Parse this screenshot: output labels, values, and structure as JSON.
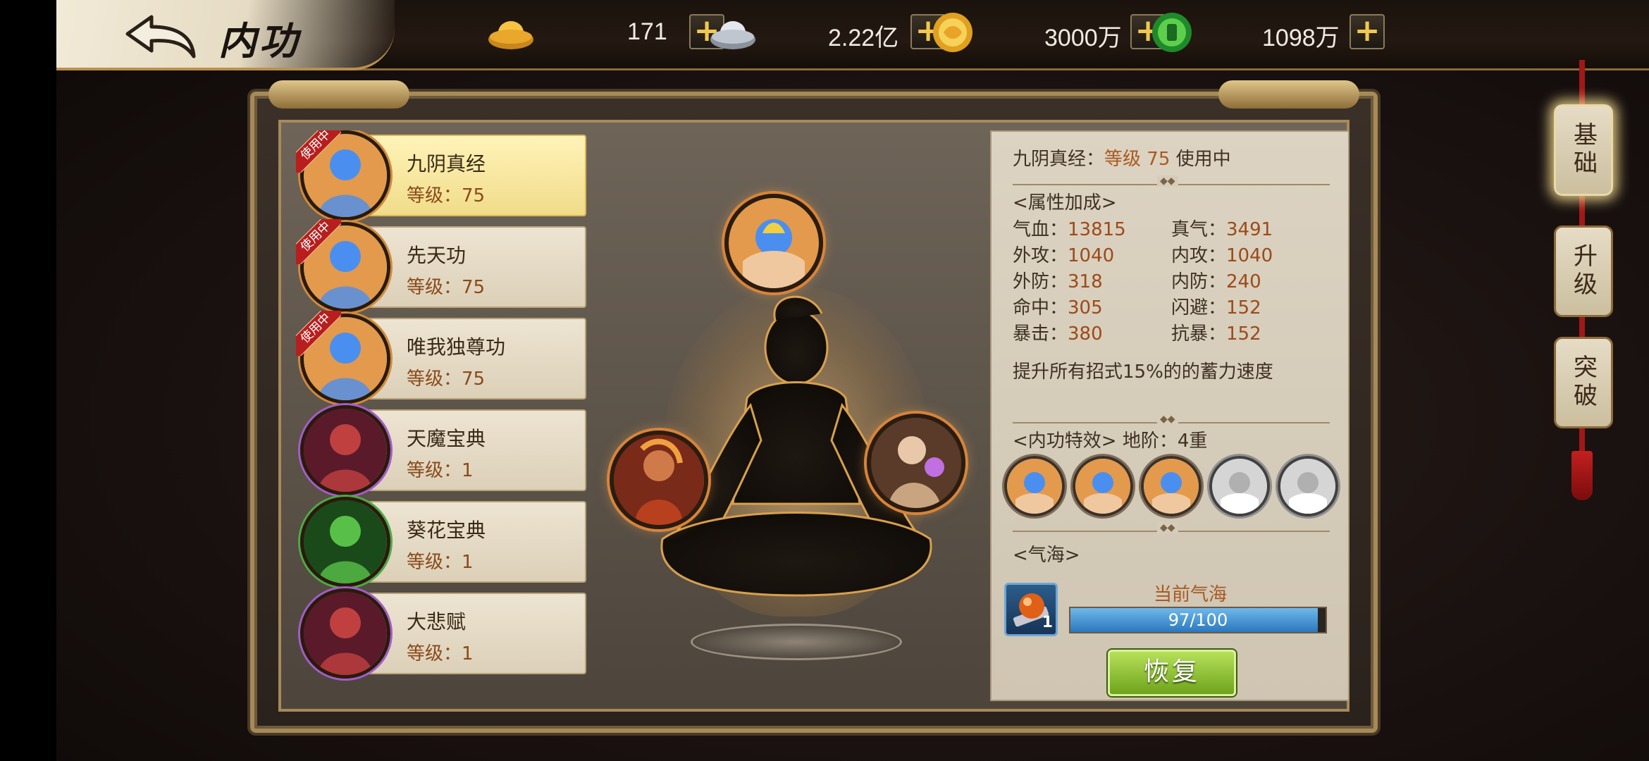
{
  "header": {
    "title": "内功",
    "resources": [
      {
        "name": "gold-ingot",
        "value": "171"
      },
      {
        "name": "silver-ingot",
        "value": "2.22亿"
      },
      {
        "name": "copper-coin",
        "value": "3000万"
      },
      {
        "name": "jade-coin",
        "value": "1098万"
      }
    ],
    "plus_label": "+"
  },
  "side_tabs": [
    {
      "label": "基础",
      "active": true
    },
    {
      "label": "升级",
      "active": false
    },
    {
      "label": "突破",
      "active": false
    }
  ],
  "in_use_label": "使用中",
  "gong_list": [
    {
      "name": "九阴真经",
      "level": "等级：75",
      "in_use": true,
      "selected": true,
      "ring": "orange"
    },
    {
      "name": "先天功",
      "level": "等级：75",
      "in_use": true,
      "selected": false,
      "ring": "orange"
    },
    {
      "name": "唯我独尊功",
      "level": "等级：75",
      "in_use": true,
      "selected": false,
      "ring": "orange"
    },
    {
      "name": "天魔宝典",
      "level": "等级：1",
      "in_use": false,
      "selected": false,
      "ring": "purple"
    },
    {
      "name": "葵花宝典",
      "level": "等级：1",
      "in_use": false,
      "selected": false,
      "ring": "green"
    },
    {
      "name": "大悲赋",
      "level": "等级：1",
      "in_use": false,
      "selected": false,
      "ring": "purple"
    }
  ],
  "detail": {
    "title_name": "九阴真经：",
    "title_level": "等级 75",
    "title_status": "使用中",
    "attr_header": "<属性加成>",
    "stats": [
      {
        "label": "气血：",
        "value": "13815"
      },
      {
        "label": "真气：",
        "value": "3491"
      },
      {
        "label": "外攻：",
        "value": "1040"
      },
      {
        "label": "内攻：",
        "value": "1040"
      },
      {
        "label": "外防：",
        "value": "318"
      },
      {
        "label": "内防：",
        "value": "240"
      },
      {
        "label": "命中：",
        "value": "305"
      },
      {
        "label": "闪避：",
        "value": "152"
      },
      {
        "label": "暴击：",
        "value": "380"
      },
      {
        "label": "抗暴：",
        "value": "152"
      }
    ],
    "bonus_text": "提升所有招式15%的的蓄力速度",
    "effect_header": "<内功特效>",
    "effect_tier": "地阶：4重",
    "effects_unlocked": 3,
    "effects_total": 5,
    "qihai_header": "<气海>",
    "qihai_label": "当前气海",
    "qihai_item_count": "1",
    "qihai_text": "97/100",
    "qihai_current": 97,
    "qihai_max": 100,
    "restore_label": "恢复"
  },
  "colors": {
    "accent_gold": "#d8843a",
    "panel_border": "#a68a58",
    "progress_blue": "#2b78bd",
    "button_green": "#6ea41c"
  }
}
